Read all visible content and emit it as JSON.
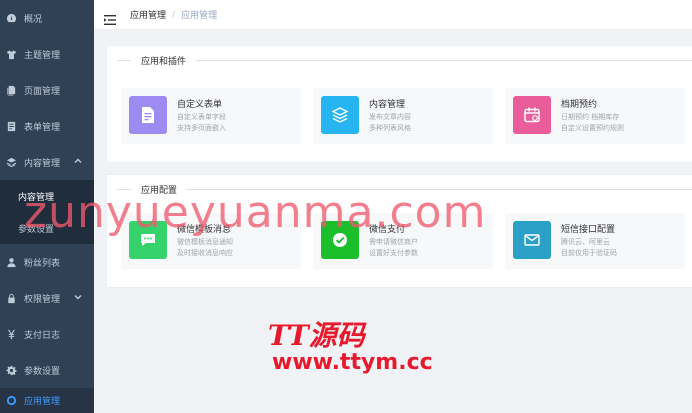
{
  "sidebar": {
    "items": [
      {
        "label": "概况",
        "icon": "dashboard-icon"
      },
      {
        "label": "主题管理",
        "icon": "shirt-icon"
      },
      {
        "label": "页面管理",
        "icon": "pages-icon"
      },
      {
        "label": "表单管理",
        "icon": "form-icon"
      },
      {
        "label": "内容管理",
        "icon": "layers-icon"
      },
      {
        "label": "粉丝列表",
        "icon": "user-icon"
      },
      {
        "label": "权限管理",
        "icon": "lock-icon"
      },
      {
        "label": "支付日志",
        "icon": "yen-icon"
      },
      {
        "label": "参数设置",
        "icon": "gear-icon"
      },
      {
        "label": "应用管理",
        "icon": "apps-icon"
      }
    ],
    "submenu": [
      {
        "label": "内容管理"
      },
      {
        "label": "参数设置"
      }
    ]
  },
  "header": {
    "crumb_root": "应用管理",
    "crumb_sep": "/",
    "crumb_current": "应用管理"
  },
  "sections": [
    {
      "title": "应用和插件",
      "apps": [
        {
          "name": "自定义表单",
          "desc1": "自定义表单字段",
          "desc2": "支持多页面嵌入",
          "color": "#9d8bf2",
          "icon": "form-doc-icon"
        },
        {
          "name": "内容管理",
          "desc1": "发布文章内容",
          "desc2": "多种列表风格",
          "color": "#26b5f0",
          "icon": "layers-icon"
        },
        {
          "name": "档期预约",
          "desc1": "日期预约 档期库存",
          "desc2": "自定义设置预约规则",
          "color": "#e85d9a",
          "icon": "calendar-icon"
        }
      ]
    },
    {
      "title": "应用配置",
      "apps": [
        {
          "name": "微信模板消息",
          "desc1": "微信模板消息通知",
          "desc2": "及时接收消息响应",
          "color": "#36d36d",
          "icon": "chat-icon"
        },
        {
          "name": "微信支付",
          "desc1": "需申请微信商户",
          "desc2": "设置好支付参数",
          "color": "#1bbf2a",
          "icon": "check-icon"
        },
        {
          "name": "短信接口配置",
          "desc1": "腾讯云、阿里云",
          "desc2": "目前仅用于验证码",
          "color": "#2aa0c7",
          "icon": "mail-icon"
        }
      ]
    }
  ],
  "watermarks": {
    "domain": "zunyueyuanma.com",
    "brand": "TT源码",
    "url": "www.ttym.cc"
  }
}
